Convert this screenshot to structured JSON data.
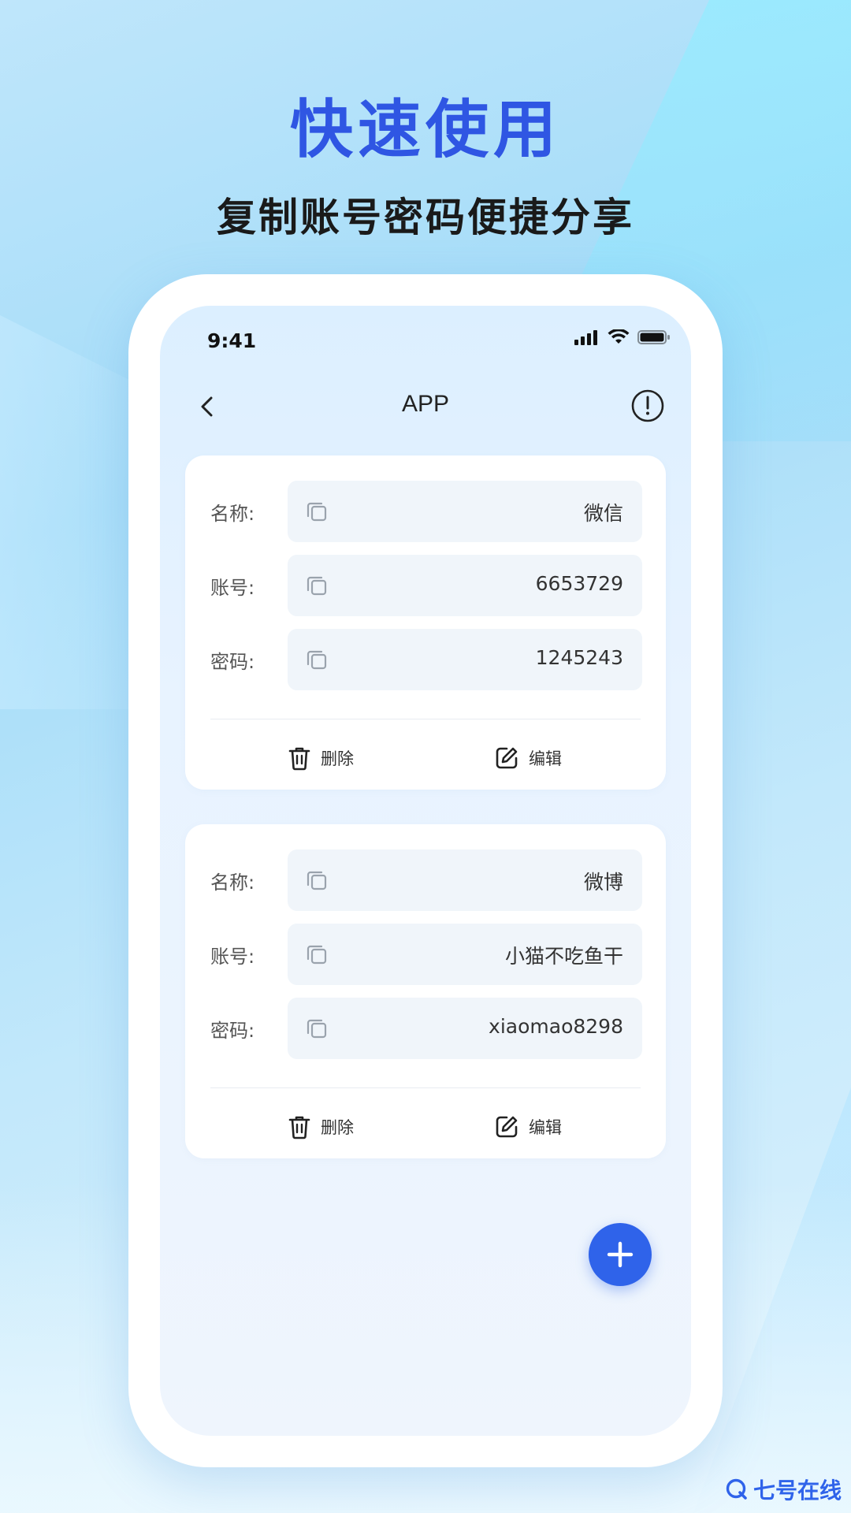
{
  "promo": {
    "headline": "快速使用",
    "subheadline": "复制账号密码便捷分享"
  },
  "status_bar": {
    "time": "9:41",
    "icons": [
      "signal-icon",
      "wifi-icon",
      "battery-icon"
    ]
  },
  "nav": {
    "back_icon": "chevron-left-icon",
    "title": "APP",
    "info_icon": "info-circle-icon"
  },
  "cards": [
    {
      "fields": [
        {
          "label": "名称:",
          "value": "微信"
        },
        {
          "label": "账号:",
          "value": "6653729"
        },
        {
          "label": "密码:",
          "value": "1245243"
        }
      ],
      "actions": {
        "delete": "删除",
        "edit": "编辑"
      }
    },
    {
      "fields": [
        {
          "label": "名称:",
          "value": "微博"
        },
        {
          "label": "账号:",
          "value": "小猫不吃鱼干"
        },
        {
          "label": "密码:",
          "value": "xiaomao8298"
        }
      ],
      "actions": {
        "delete": "删除",
        "edit": "编辑"
      }
    }
  ],
  "fab_icon": "plus-icon",
  "watermark": {
    "text": "七号在线",
    "icon": "logo-q-icon"
  },
  "colors": {
    "accent": "#2f63ea",
    "headline": "#2f56e3"
  }
}
